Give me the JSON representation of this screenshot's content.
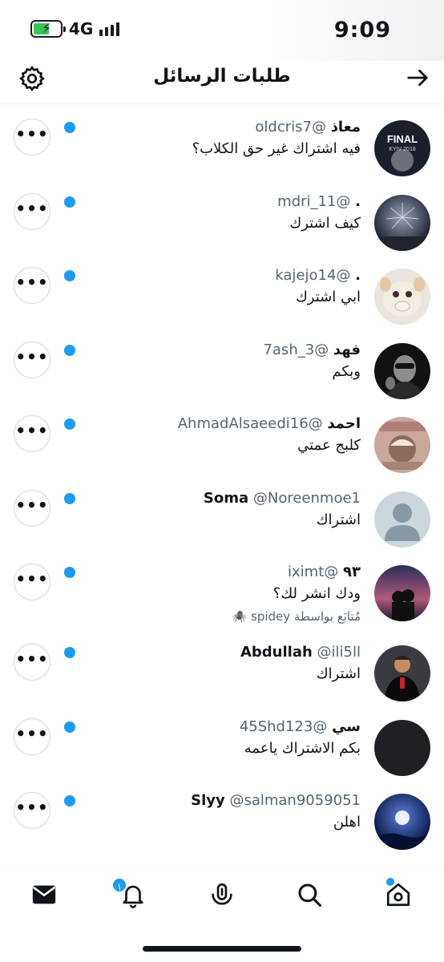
{
  "status_bar": {
    "time": "9:09",
    "network": "4G"
  },
  "header": {
    "title": "طلبات الرسائل"
  },
  "requests": [
    {
      "name": "معاذ",
      "handle": "@oldcris7",
      "message": "فيه اشتراك غير حق الكلاب؟",
      "avatar_text": "FINAL\nKYIV 2018",
      "follow_note": ""
    },
    {
      "name": ".",
      "handle": "@mdri_11",
      "message": "كيف اشترك",
      "avatar_text": "",
      "follow_note": ""
    },
    {
      "name": ".",
      "handle": "@kajejo14",
      "message": "ابي اشترك",
      "avatar_text": "",
      "follow_note": ""
    },
    {
      "name": "فهد",
      "handle": "@7ash_3",
      "message": "وبكم",
      "avatar_text": "",
      "follow_note": ""
    },
    {
      "name": "احمد",
      "handle": "@AhmadAlsaeedi16",
      "message": "كلبج عمتي",
      "avatar_text": "",
      "follow_note": ""
    },
    {
      "name": "Soma",
      "handle": "@Noreenmoe1",
      "message": "اشتراك",
      "avatar_text": "",
      "follow_note": ""
    },
    {
      "name": "٩٣",
      "handle": "@iximt",
      "message": "ودك انشر لك؟",
      "avatar_text": "",
      "follow_note": "مُتابَع بواسطة spidey 🕷️"
    },
    {
      "name": "Abdullah",
      "handle": "@ili5ll",
      "message": "اشتراك",
      "avatar_text": "",
      "follow_note": ""
    },
    {
      "name": "سي",
      "handle": "@45Shd123",
      "message": "بكم الاشتراك ياعمه",
      "avatar_text": "",
      "follow_note": ""
    },
    {
      "name": "Slyy",
      "handle": "@salman9059051",
      "message": "اهلن",
      "avatar_text": "",
      "follow_note": ""
    }
  ],
  "more_glyph": "•••",
  "tabbar": {
    "notification_badge": "١",
    "icons": [
      "mail-icon",
      "bell-icon",
      "spaces-icon",
      "search-icon",
      "home-icon"
    ]
  },
  "colors": {
    "accent": "#1d9bf0",
    "text": "#0f1419",
    "secondary": "#536471"
  }
}
